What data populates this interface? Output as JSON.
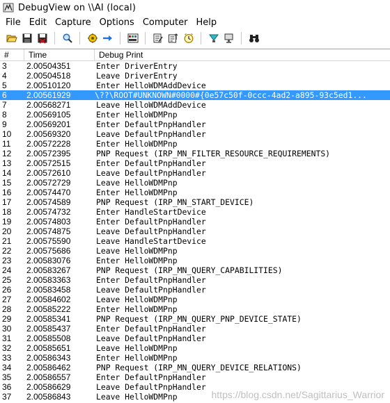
{
  "window": {
    "title": "DebugView on \\\\AI (local)"
  },
  "menu": [
    "File",
    "Edit",
    "Capture",
    "Options",
    "Computer",
    "Help"
  ],
  "toolbar": {
    "icons": [
      "open-icon",
      "save-icon",
      "clear-icon",
      "find-icon",
      "capture-icon",
      "autoscroll-icon",
      "highlight-icon",
      "filter-icon",
      "history-icon",
      "clock-icon",
      "connect-icon",
      "disconnect-icon",
      "binoculars-icon"
    ],
    "colors": {
      "highlight": "#3399ff",
      "blue": "#1e6fd6",
      "red": "#cc1111",
      "gold": "#d9a400"
    }
  },
  "columns": {
    "num": "#",
    "time": "Time",
    "print": "Debug Print"
  },
  "rows": [
    {
      "num": "3",
      "time": "2.00504351",
      "print": "Enter DriverEntry"
    },
    {
      "num": "4",
      "time": "2.00504518",
      "print": "Leave DriverEntry"
    },
    {
      "num": "5",
      "time": "2.00510120",
      "print": "Enter HelloWDMAddDevice"
    },
    {
      "num": "6",
      "time": "2.00561929",
      "print": "\\??\\ROOT#UNKNOWN#0000#{0e57c50f-0ccc-4ad2-a895-93c5ed1...",
      "selected": true
    },
    {
      "num": "7",
      "time": "2.00568271",
      "print": "Leave HelloWDMAddDevice"
    },
    {
      "num": "8",
      "time": "2.00569105",
      "print": "Enter HelloWDMPnp"
    },
    {
      "num": "9",
      "time": "2.00569201",
      "print": "Enter DefaultPnpHandler"
    },
    {
      "num": "10",
      "time": "2.00569320",
      "print": "Leave DefaultPnpHandler"
    },
    {
      "num": "11",
      "time": "2.00572228",
      "print": "Enter HelloWDMPnp"
    },
    {
      "num": "12",
      "time": "2.00572395",
      "print": "PNP Request (IRP_MN_FILTER_RESOURCE_REQUIREMENTS)"
    },
    {
      "num": "13",
      "time": "2.00572515",
      "print": "Enter DefaultPnpHandler"
    },
    {
      "num": "14",
      "time": "2.00572610",
      "print": "Leave DefaultPnpHandler"
    },
    {
      "num": "15",
      "time": "2.00572729",
      "print": "Leave HelloWDMPnp"
    },
    {
      "num": "16",
      "time": "2.00574470",
      "print": "Enter HelloWDMPnp"
    },
    {
      "num": "17",
      "time": "2.00574589",
      "print": "PNP Request (IRP_MN_START_DEVICE)"
    },
    {
      "num": "18",
      "time": "2.00574732",
      "print": "Enter HandleStartDevice"
    },
    {
      "num": "19",
      "time": "2.00574803",
      "print": "Enter DefaultPnpHandler"
    },
    {
      "num": "20",
      "time": "2.00574875",
      "print": "Leave DefaultPnpHandler"
    },
    {
      "num": "21",
      "time": "2.00575590",
      "print": "Leave HandleStartDevice"
    },
    {
      "num": "22",
      "time": "2.00575686",
      "print": "Leave HelloWDMPnp"
    },
    {
      "num": "23",
      "time": "2.00583076",
      "print": "Enter HelloWDMPnp"
    },
    {
      "num": "24",
      "time": "2.00583267",
      "print": "PNP Request (IRP_MN_QUERY_CAPABILITIES)"
    },
    {
      "num": "25",
      "time": "2.00583363",
      "print": "Enter DefaultPnpHandler"
    },
    {
      "num": "26",
      "time": "2.00583458",
      "print": "Leave DefaultPnpHandler"
    },
    {
      "num": "27",
      "time": "2.00584602",
      "print": "Leave HelloWDMPnp"
    },
    {
      "num": "28",
      "time": "2.00585222",
      "print": "Enter HelloWDMPnp"
    },
    {
      "num": "29",
      "time": "2.00585341",
      "print": "PNP Request (IRP_MN_QUERY_PNP_DEVICE_STATE)"
    },
    {
      "num": "30",
      "time": "2.00585437",
      "print": "Enter DefaultPnpHandler"
    },
    {
      "num": "31",
      "time": "2.00585508",
      "print": "Leave DefaultPnpHandler"
    },
    {
      "num": "32",
      "time": "2.00585651",
      "print": "Leave HelloWDMPnp"
    },
    {
      "num": "33",
      "time": "2.00586343",
      "print": "Enter HelloWDMPnp"
    },
    {
      "num": "34",
      "time": "2.00586462",
      "print": "PNP Request (IRP_MN_QUERY_DEVICE_RELATIONS)"
    },
    {
      "num": "35",
      "time": "2.00586557",
      "print": "Enter DefaultPnpHandler"
    },
    {
      "num": "36",
      "time": "2.00586629",
      "print": "Leave DefaultPnpHandler"
    },
    {
      "num": "37",
      "time": "2.00586843",
      "print": "Leave HelloWDMPnp"
    }
  ],
  "watermark": "https://blog.csdn.net/Sagittarius_Warrior"
}
